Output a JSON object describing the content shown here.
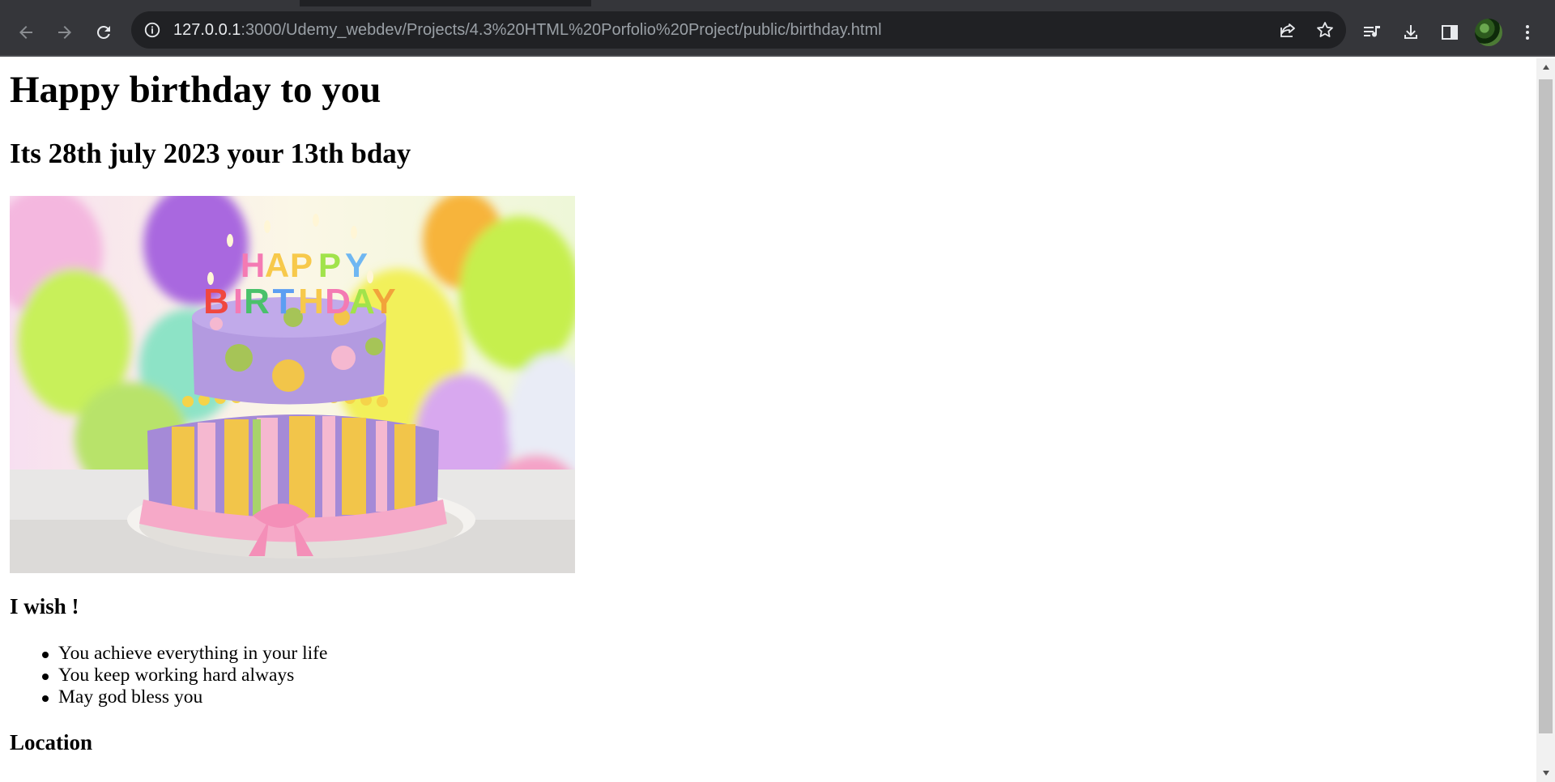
{
  "browser": {
    "url_host": "127.0.0.1",
    "url_rest": ":3000/Udemy_webdev/Projects/4.3%20HTML%20Porfolio%20Project/public/birthday.html",
    "icons": [
      "back-arrow-icon",
      "forward-arrow-icon",
      "reload-icon",
      "info-icon",
      "share-icon",
      "star-icon",
      "media-queue-icon",
      "download-icon",
      "side-panel-icon",
      "profile-avatar",
      "kebab-menu-icon"
    ]
  },
  "page": {
    "title": "Happy birthday to you",
    "subtitle": "Its 28th july 2023 your 13th bday",
    "image_alt": "HAPPY BIRTHDAY",
    "wish_heading": "I wish !",
    "wishes": [
      "You achieve everything in your life",
      "You keep working hard always",
      "May god bless you"
    ],
    "location_heading": "Location"
  },
  "colors": {
    "chrome_bg": "#35363a",
    "omnibox_bg": "#202124",
    "page_bg": "#ffffff"
  }
}
